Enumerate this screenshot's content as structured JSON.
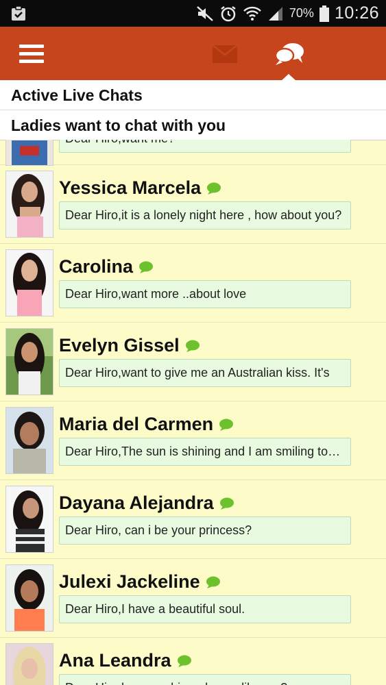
{
  "status_bar": {
    "battery": "70%",
    "time": "10:26",
    "icons": [
      "clipboard-check-icon",
      "mute-icon",
      "alarm-icon",
      "wifi-icon",
      "signal-icon",
      "battery-icon"
    ]
  },
  "app_bar": {
    "icons": [
      "menu-icon",
      "mail-icon",
      "chat-icon"
    ],
    "accent": "#c7451c"
  },
  "sections": {
    "active": "Active Live Chats",
    "ladies": "Ladies want to chat with you"
  },
  "partial_item": {
    "message": "Dear Hiro,want me?"
  },
  "chats": [
    {
      "name": "Yessica Marcela",
      "message": "Dear Hiro,it is a lonely night here , how about you?"
    },
    {
      "name": "Carolina",
      "message": "Dear Hiro,want more ..about love"
    },
    {
      "name": "Evelyn Gissel",
      "message": "Dear Hiro,want to give me an Australian kiss. It's"
    },
    {
      "name": "Maria del Carmen",
      "message": "Dear Hiro,The sun is shining and I am smiling today"
    },
    {
      "name": "Dayana Alejandra",
      "message": "Dear Hiro, can i be your princess?"
    },
    {
      "name": "Julexi Jackeline",
      "message": "Dear Hiro,I have a beautiful soul."
    },
    {
      "name": "Ana Leandra",
      "message": "Dear Hiro,hey sunshine, do you like me?"
    }
  ],
  "colors": {
    "list_background": "#fdfbc8",
    "message_background": "#e8fbe0",
    "online_bubble": "#6cc12c"
  }
}
